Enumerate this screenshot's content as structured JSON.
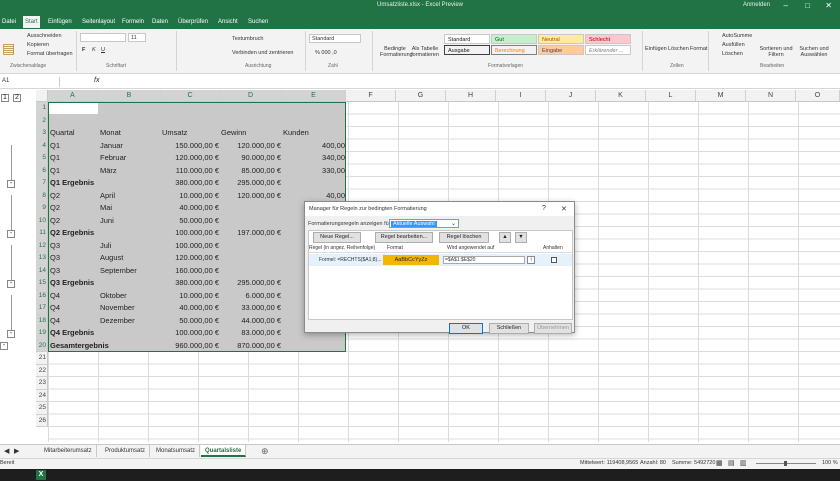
{
  "titlebar": {
    "title": "Umsatzliste.xlsx - Excel Preview",
    "account": "Anmelden",
    "min": "–",
    "max": "□",
    "close": "✕"
  },
  "tabs": [
    "Datei",
    "Start",
    "Einfügen",
    "Seitenlayout",
    "Formeln",
    "Daten",
    "Überprüfen",
    "Ansicht",
    "Suchen"
  ],
  "ribbon": {
    "clipboard": {
      "cut": "Ausschneiden",
      "copy": "Kopieren",
      "painter": "Format übertragen",
      "paste": "Einfügen",
      "group": "Zwischenablage"
    },
    "font": {
      "name": "",
      "size": "11",
      "group": "Schriftart"
    },
    "alignment": {
      "wrap": "Textumbruch",
      "merge": "Verbinden und zentrieren",
      "group": "Ausrichtung"
    },
    "number": {
      "format": "Standard",
      "group": "Zahl"
    },
    "styles": {
      "cond": "Bedingte Formatierung",
      "table": "Als Tabelle formatieren",
      "cells": [
        "Standard",
        "Gut",
        "Neutral",
        "Schlecht",
        "Ausgabe",
        "Berechnung",
        "Eingabe",
        "Erklärender ..."
      ],
      "group": "Formatvorlagen"
    },
    "cells_grp": {
      "insert": "Einfügen",
      "delete": "Löschen",
      "format": "Format",
      "group": "Zellen"
    },
    "editing": {
      "autosum": "AutoSumme",
      "fill": "Ausfüllen",
      "clear": "Löschen",
      "sort": "Sortieren und Filtern",
      "find": "Suchen und Auswählen",
      "group": "Bearbeiten"
    }
  },
  "formula_bar": {
    "namebox": "A1",
    "fx": "fx",
    "content": ""
  },
  "columns": [
    "A",
    "B",
    "C",
    "D",
    "E",
    "F",
    "G",
    "H",
    "I",
    "J",
    "K",
    "L",
    "M",
    "N",
    "O"
  ],
  "rows": [
    "1",
    "2",
    "3",
    "4",
    "5",
    "6",
    "7",
    "8",
    "9",
    "10",
    "11",
    "12",
    "13",
    "14",
    "15",
    "16",
    "17",
    "18",
    "19",
    "20",
    "21",
    "22",
    "23",
    "24",
    "25",
    "26"
  ],
  "table": [
    [
      "",
      "",
      "",
      "",
      ""
    ],
    [
      "",
      "",
      "",
      "",
      ""
    ],
    [
      "Quartal",
      "Monat",
      "Umsatz",
      "Gewinn",
      "Kunden"
    ],
    [
      "Q1",
      "Januar",
      "150.000,00 €",
      "120.000,00 €",
      "400,00"
    ],
    [
      "Q1",
      "Februar",
      "120.000,00 €",
      "90.000,00 €",
      "340,00"
    ],
    [
      "Q1",
      "März",
      "110.000,00 €",
      "85.000,00 €",
      "330,00"
    ],
    [
      "Q1 Ergebnis",
      "",
      "380.000,00 €",
      "295.000,00 €",
      ""
    ],
    [
      "Q2",
      "April",
      "10.000,00 €",
      "120.000,00 €",
      "40,00"
    ],
    [
      "Q2",
      "Mai",
      "40.000,00 €",
      "",
      ""
    ],
    [
      "Q2",
      "Juni",
      "50.000,00 €",
      "",
      ""
    ],
    [
      "Q2 Ergebnis",
      "",
      "100.000,00 €",
      "",
      ""
    ],
    [
      "Q3",
      "Juli",
      "100.000,00 €",
      "",
      ""
    ],
    [
      "Q3",
      "August",
      "120.000,00 €",
      "",
      ""
    ],
    [
      "Q3",
      "September",
      "160.000,00 €",
      "",
      ""
    ],
    [
      "Q3 Ergebnis",
      "",
      "380.000,00 €",
      "",
      ""
    ],
    [
      "Q4",
      "Oktober",
      "10.000,00 €",
      "",
      ""
    ],
    [
      "Q4",
      "November",
      "40.000,00 €",
      "",
      ""
    ],
    [
      "Q4",
      "Dezember",
      "50.000,00 €",
      "",
      ""
    ],
    [
      "Q4 Ergebnis",
      "",
      "100.000,00 €",
      "",
      ""
    ],
    [
      "Gesamtergebnis",
      "",
      "960.000,00 €",
      "",
      ""
    ]
  ],
  "hidden_by_dialog_d": [
    "",
    "",
    "",
    "",
    "",
    "",
    "",
    "",
    "",
    "",
    "197.000,00 €",
    "",
    "",
    "",
    "295.000,00 €",
    "6.000,00 €",
    "33.000,00 €",
    "44.000,00 €",
    "83.000,00 €",
    "870.000,00 €"
  ],
  "sheet_tabs": [
    "Mitarbeiterumsatz",
    "Produktumsatz",
    "Monatsumsatz",
    "Quartalsliste"
  ],
  "active_sheet": "Quartalsliste",
  "status": {
    "mode": "Bereit",
    "mittelwert": "Mittelwert: 119408,9565",
    "anzahl": "Anzahl: 80",
    "summe": "Summe: 5492720",
    "zoom": "100 %"
  },
  "dialog": {
    "title": "Manager für Regeln zur bedingten Formatierung",
    "help": "?",
    "close": "✕",
    "show_label": "Formatierungsregeln anzeigen für:",
    "show_value": "Aktuelle Auswahl",
    "new_rule": "Neue Regel...",
    "edit_rule": "Regel bearbeiten...",
    "delete_rule": "Regel löschen",
    "col_rule": "Regel (in angez. Reihenfolge)",
    "col_format": "Format",
    "col_applies": "Wird angewendet auf",
    "col_stop": "Anhalten",
    "rule_text": "Formel: =RECHTS($A1;8)...",
    "format_preview": "AaBbCcYyZz",
    "applies_to": "=$A$1:$E$20",
    "ok": "OK",
    "closebtn": "Schließen",
    "apply": "Übernehmen",
    "colors": {
      "preview_bg": "#f2b705"
    }
  }
}
